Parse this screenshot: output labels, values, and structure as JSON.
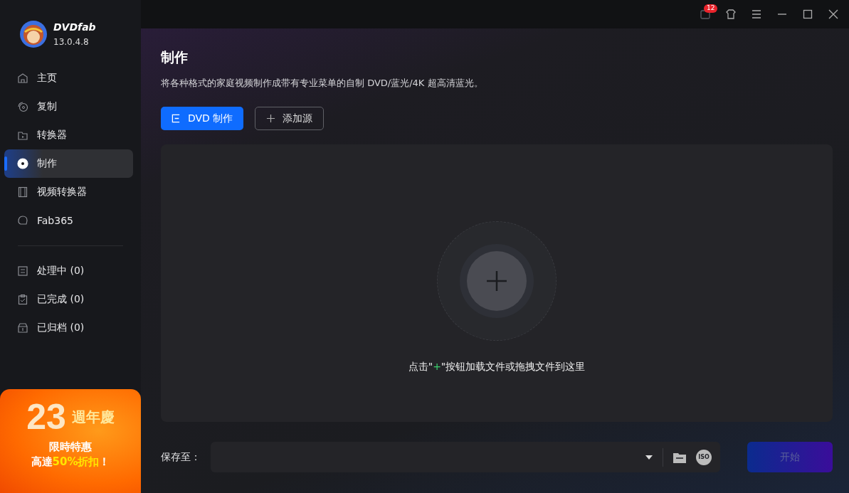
{
  "app": {
    "name": "DVDfab",
    "version": "13.0.4.8"
  },
  "nav": [
    {
      "label": "主页",
      "kind": "home",
      "selected": false
    },
    {
      "label": "复制",
      "kind": "copy",
      "selected": false
    },
    {
      "label": "转换器",
      "kind": "converter",
      "selected": false
    },
    {
      "label": "制作",
      "kind": "creator",
      "selected": true
    },
    {
      "label": "视频转换器",
      "kind": "film",
      "selected": false
    },
    {
      "label": "Fab365",
      "kind": "fab",
      "selected": false
    }
  ],
  "queues": [
    {
      "label": "处理中 (0)",
      "kind": "processing"
    },
    {
      "label": "已完成 (0)",
      "kind": "done"
    },
    {
      "label": "已归档 (0)",
      "kind": "archive"
    }
  ],
  "promo": {
    "number": "23",
    "title": "週年慶",
    "line1": "限時特惠",
    "line2": [
      {
        "text": "高達",
        "kind": "plain"
      },
      {
        "text": "50%折扣",
        "kind": "accent"
      },
      {
        "text": "！",
        "kind": "plain"
      }
    ]
  },
  "titlebar": {
    "badge": "12"
  },
  "page": {
    "title": "制作",
    "description": "将各种格式的家庭视频制作成带有专业菜单的自制 DVD/蓝光/4K 超高清蓝光。"
  },
  "actions": [
    {
      "label": "DVD 制作",
      "kind": "primary"
    },
    {
      "label": "添加源",
      "kind": "outline"
    }
  ],
  "drop": {
    "hint": [
      {
        "text": "点击\"",
        "kind": "plain"
      },
      {
        "text": "+",
        "kind": "accent"
      },
      {
        "text": "\"按钮加载文件或拖拽文件到这里",
        "kind": "plain"
      }
    ]
  },
  "save": {
    "label": "保存至：",
    "start": "开始",
    "iso_label": "ISO"
  }
}
